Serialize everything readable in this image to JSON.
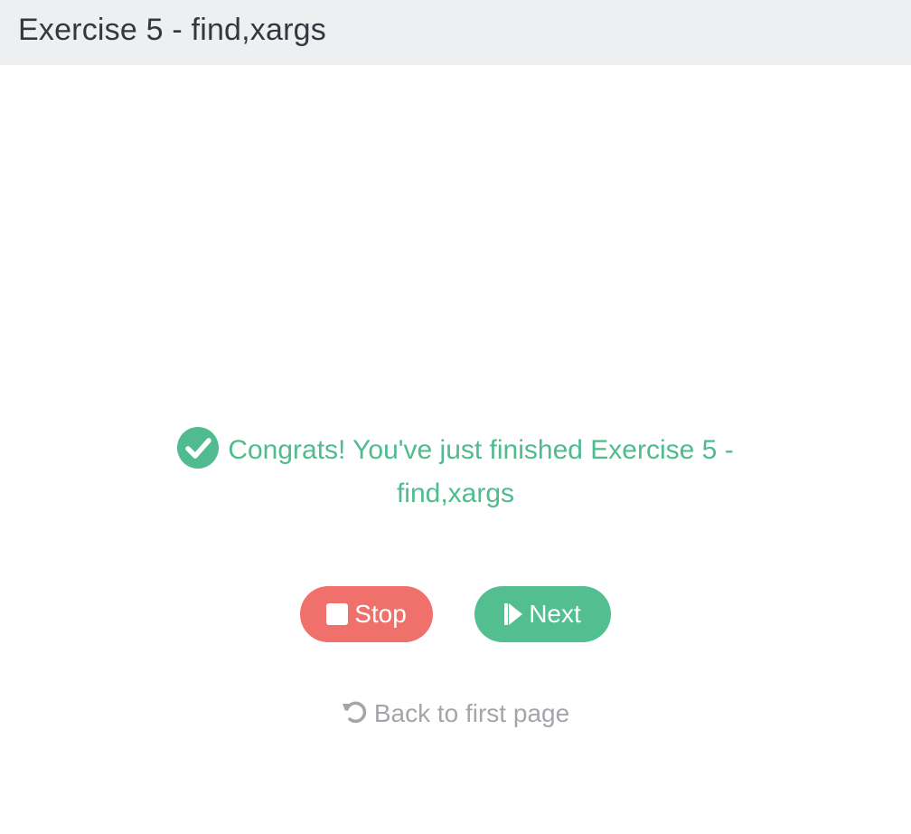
{
  "header": {
    "title": "Exercise 5 - find,xargs"
  },
  "message": {
    "text": "Congrats! You've just finished Exercise 5 - find,xargs",
    "icon": "check-circle-icon",
    "color": "#4fbb8f"
  },
  "buttons": {
    "stop_label": "Stop",
    "stop_icon": "stop-icon",
    "stop_color": "#f0716b",
    "next_label": "Next",
    "next_icon": "step-forward-icon",
    "next_color": "#53be90"
  },
  "back_link": {
    "label": "Back to first page",
    "icon": "undo-icon"
  }
}
